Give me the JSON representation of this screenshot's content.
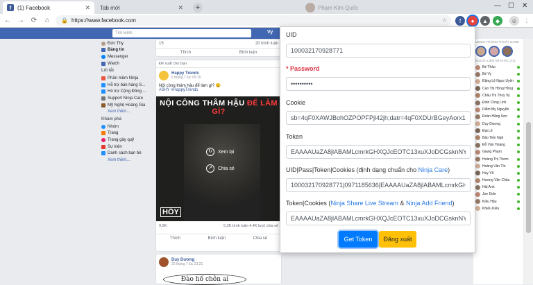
{
  "browser": {
    "tabs": [
      {
        "title": "(1) Facebook",
        "active": true
      },
      {
        "title": "Tab mới",
        "active": false
      }
    ],
    "url": "https://www.facebook.com",
    "bg_profile_name": "Phạm Kim Quốc"
  },
  "fb": {
    "search_placeholder": "Tìm kiếm",
    "header_user": "Vy",
    "left_nav": {
      "profile": "Đức Thy",
      "main": [
        "Bảng tin",
        "Messenger",
        "Watch"
      ],
      "shortcuts_title": "Lối tắt",
      "shortcuts": [
        "Phần mềm Ninja",
        "Hỗ trợ bán hàng S...",
        "Hỗ trợ Cộng Đồng ...",
        "Support Ninja Care",
        "Mỹ Nghệ Hoàng Gia"
      ],
      "more1": "Xem thêm...",
      "explore_title": "Khám phá",
      "explore": [
        "Nhóm",
        "Trang",
        "Trang gây quỹ",
        "Sự kiện",
        "Danh sách bạn bè"
      ],
      "more2": "Xem thêm..."
    },
    "top_card": {
      "count": "15",
      "comments": "20 bình luận",
      "like": "Thích",
      "comment": "Bình luận"
    },
    "suggested_label": "Đề xuất cho bạn",
    "post": {
      "page": "Happy Trends",
      "time": "6 tháng 7 lúc 09:15",
      "text": "Nội công thâm hậu để làm gì? 😉",
      "tag": "#SHY #HappyTrends",
      "banner_white": "NỘI CÔNG THÂM HẬU",
      "banner_red": "ĐỂ LÀM GÌ?",
      "replay": "Xem lại",
      "share": "Chia sẻ",
      "watermark": "HÔY",
      "reactions": "9,9K",
      "stats": "5,2K bình luận  4,4K lượt chia sẻ",
      "like": "Thích",
      "comment": "Bình luận",
      "share_btn": "Chia sẻ"
    },
    "post2": {
      "author": "Duy Dương",
      "time": "20 tháng 7 lúc 23:21",
      "image_text": "Đào hố chôn ai"
    },
    "right_sidebar": {
      "stories_header": "VIDEO TƯỜNG THUẬT GAME",
      "contacts_header": "NGƯỜI LIÊN HỆ KHÁC (73)",
      "contacts": [
        "Bé Thảo",
        "Bé Vy",
        "Đặng Lệ Ngọc Uyên",
        "Cao Thị Hồng Hồng",
        "Châu Thị Thuỳ Vy",
        "Đinh Công Linh",
        "Diễm My Nguyễn",
        "Đoàn Hằng Sơn",
        "Duy Dương",
        "Đạt Lê",
        "Bảo Tiến Ngô",
        "Đỗ Văn Hoàng",
        "Giang Phạm",
        "Hoàng Thị Thơm",
        "Hoàng Văn Tín",
        "Huy Võ",
        "Hương Văn Châu",
        "Hải Anh",
        "Joe Dole",
        "Kiều Hậu",
        "Khiếu Kiều"
      ],
      "search_placeholder": "Tìm kiếm"
    }
  },
  "popup": {
    "uid_label": "UID",
    "uid_value": "100032170928771",
    "password_label": "* Password",
    "password_value": "••••••••••",
    "cookie_label": "Cookie",
    "cookie_value": "sb=4qF0XAWJBohOZPOPFPjl42jh;datr=4qF0XDUrBGeyAorx1G\\",
    "token_label": "Token",
    "token_value": "EAAAAUaZA8jlABAMLcmrkGHXQJcEOTC13xuXJoDCGsknNYiVa",
    "combo1_label_prefix": "UID|Pass|Token|Cookies (định dạng chuẩn cho ",
    "combo1_link": "Ninja Care",
    "combo1_label_suffix": ")",
    "combo1_value": "100032170928771|0971185636|EAAAAUaZA8jlABAMLcmrkGHX",
    "combo2_label_prefix": "Token|Cookies (",
    "combo2_link1": "Ninja Share Live Stream",
    "combo2_amp": " & ",
    "combo2_link2": "Ninja Add Friend",
    "combo2_label_suffix": ")",
    "combo2_value": "EAAAAUaZA8jlABAMLcmrkGHXQJcEOTC13xuXJoDCGsknNYiVa",
    "get_token": "Get Token",
    "logout": "Đăng xuất"
  },
  "colors": {
    "fb_blue": "#4267b2",
    "primary": "#007bff",
    "warning": "#ffc107",
    "required": "#dc3545"
  }
}
